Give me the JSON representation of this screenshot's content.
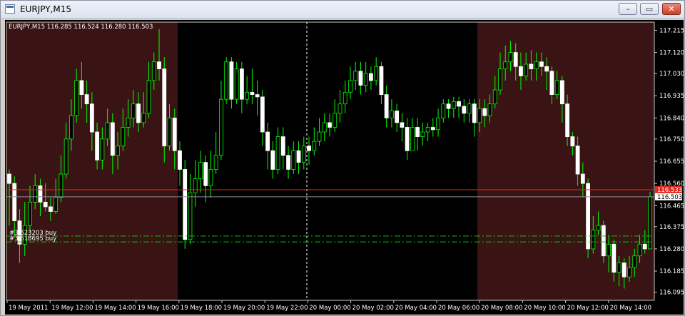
{
  "window": {
    "title": "EURJPY,M15",
    "minimize_glyph": "–",
    "restore_glyph": "▭",
    "close_glyph": "✕"
  },
  "chart_data": {
    "type": "candlestick",
    "header": "EURJPY,M15  116.285 116.524 116.280 116.503",
    "ylim": [
      116.06,
      117.25
    ],
    "y_ticks": [
      117.215,
      117.12,
      117.03,
      116.935,
      116.84,
      116.75,
      116.655,
      116.56,
      116.465,
      116.375,
      116.28,
      116.185,
      116.095
    ],
    "y_tick_labels": [
      "117.215",
      "117.120",
      "117.030",
      "116.935",
      "116.840",
      "116.750",
      "116.655",
      "116.560",
      "116.465",
      "116.375",
      "116.280",
      "116.185",
      "116.095"
    ],
    "x_tick_labels": [
      "19 May 2011",
      "19 May 12:00",
      "19 May 14:00",
      "19 May 16:00",
      "19 May 18:00",
      "19 May 20:00",
      "19 May 22:00",
      "20 May 00:00",
      "20 May 02:00",
      "20 May 04:00",
      "20 May 06:00",
      "20 May 08:00",
      "20 May 10:00",
      "20 May 12:00",
      "20 May 14:00"
    ],
    "price_lines": [
      {
        "label": "116.533",
        "value": 116.533,
        "color": "#e0281e"
      },
      {
        "label": "116.503",
        "value": 116.503,
        "color": "#8c8c9c"
      }
    ],
    "order_lines": [
      {
        "label": "#3  623203 buy",
        "value": 116.335
      },
      {
        "label": "#3  618695 buy",
        "value": 116.31
      }
    ],
    "session_shading": [
      "#3a1414",
      "#000000",
      "#3a1414"
    ],
    "candles": [
      [
        116.6,
        116.56,
        116.62,
        116.38
      ],
      [
        116.56,
        116.4,
        116.59,
        116.33
      ],
      [
        116.4,
        116.3,
        116.45,
        116.22
      ],
      [
        116.3,
        116.38,
        116.48,
        116.25
      ],
      [
        116.38,
        116.48,
        116.55,
        116.35
      ],
      [
        116.48,
        116.55,
        116.6,
        116.45
      ],
      [
        116.55,
        116.48,
        116.58,
        116.42
      ],
      [
        116.48,
        116.46,
        116.56,
        116.44
      ],
      [
        116.46,
        116.44,
        116.5,
        116.4
      ],
      [
        116.44,
        116.5,
        116.58,
        116.43
      ],
      [
        116.5,
        116.6,
        116.68,
        116.48
      ],
      [
        116.6,
        116.75,
        116.82,
        116.58
      ],
      [
        116.75,
        116.85,
        116.92,
        116.7
      ],
      [
        116.85,
        117.0,
        117.05,
        116.82
      ],
      [
        117.0,
        116.94,
        117.08,
        116.88
      ],
      [
        116.94,
        116.9,
        117.0,
        116.82
      ],
      [
        116.9,
        116.78,
        116.95,
        116.7
      ],
      [
        116.78,
        116.66,
        116.82,
        116.62
      ],
      [
        116.66,
        116.75,
        116.8,
        116.62
      ],
      [
        116.75,
        116.82,
        116.88,
        116.72
      ],
      [
        116.82,
        116.68,
        116.86,
        116.6
      ],
      [
        116.68,
        116.72,
        116.78,
        116.62
      ],
      [
        116.72,
        116.8,
        116.88,
        116.7
      ],
      [
        116.8,
        116.84,
        116.92,
        116.76
      ],
      [
        116.84,
        116.9,
        116.96,
        116.8
      ],
      [
        116.9,
        116.82,
        116.95,
        116.78
      ],
      [
        116.82,
        116.86,
        116.95,
        116.8
      ],
      [
        116.86,
        117.0,
        117.08,
        116.84
      ],
      [
        117.0,
        117.08,
        117.12,
        116.96
      ],
      [
        117.08,
        117.05,
        117.22,
        117.0
      ],
      [
        117.05,
        116.72,
        117.1,
        116.65
      ],
      [
        116.72,
        116.84,
        116.9,
        116.7
      ],
      [
        116.84,
        116.7,
        116.88,
        116.62
      ],
      [
        116.7,
        116.62,
        116.74,
        116.55
      ],
      [
        116.62,
        116.32,
        116.66,
        116.28
      ],
      [
        116.32,
        116.52,
        116.6,
        116.3
      ],
      [
        116.52,
        116.58,
        116.66,
        116.46
      ],
      [
        116.58,
        116.65,
        116.7,
        116.52
      ],
      [
        116.65,
        116.55,
        116.68,
        116.48
      ],
      [
        116.55,
        116.62,
        116.7,
        116.5
      ],
      [
        116.62,
        116.68,
        116.78,
        116.6
      ],
      [
        116.68,
        116.92,
        117.0,
        116.66
      ],
      [
        116.92,
        117.08,
        117.1,
        116.9
      ],
      [
        117.08,
        116.92,
        117.1,
        116.88
      ],
      [
        116.92,
        117.05,
        117.08,
        116.9
      ],
      [
        117.05,
        116.92,
        117.08,
        116.86
      ],
      [
        116.92,
        116.95,
        117.02,
        116.9
      ],
      [
        116.95,
        116.94,
        117.05,
        116.9
      ],
      [
        116.94,
        116.93,
        117.0,
        116.85
      ],
      [
        116.93,
        116.78,
        116.96,
        116.72
      ],
      [
        116.78,
        116.7,
        116.82,
        116.62
      ],
      [
        116.7,
        116.62,
        116.74,
        116.58
      ],
      [
        116.62,
        116.76,
        116.8,
        116.6
      ],
      [
        116.76,
        116.68,
        116.8,
        116.62
      ],
      [
        116.68,
        116.62,
        116.72,
        116.58
      ],
      [
        116.62,
        116.7,
        116.74,
        116.6
      ],
      [
        116.7,
        116.65,
        116.74,
        116.6
      ],
      [
        116.65,
        116.72,
        116.76,
        116.62
      ],
      [
        116.72,
        116.7,
        116.76,
        116.64
      ],
      [
        116.7,
        116.74,
        116.8,
        116.68
      ],
      [
        116.74,
        116.78,
        116.84,
        116.72
      ],
      [
        116.78,
        116.82,
        116.86,
        116.74
      ],
      [
        116.82,
        116.8,
        116.86,
        116.76
      ],
      [
        116.8,
        116.86,
        116.92,
        116.78
      ],
      [
        116.86,
        116.9,
        116.96,
        116.82
      ],
      [
        116.9,
        116.95,
        117.0,
        116.86
      ],
      [
        116.95,
        117.0,
        117.06,
        116.92
      ],
      [
        117.0,
        117.04,
        117.08,
        116.96
      ],
      [
        117.04,
        116.98,
        117.08,
        116.94
      ],
      [
        116.98,
        117.03,
        117.08,
        116.95
      ],
      [
        117.03,
        117.0,
        117.06,
        116.96
      ],
      [
        117.0,
        117.06,
        117.1,
        116.98
      ],
      [
        117.06,
        116.94,
        117.08,
        116.9
      ],
      [
        116.94,
        116.84,
        116.98,
        116.8
      ],
      [
        116.84,
        116.87,
        116.92,
        116.8
      ],
      [
        116.87,
        116.82,
        116.9,
        116.78
      ],
      [
        116.82,
        116.8,
        116.86,
        116.74
      ],
      [
        116.8,
        116.7,
        116.84,
        116.66
      ],
      [
        116.7,
        116.8,
        116.84,
        116.7
      ],
      [
        116.8,
        116.76,
        116.84,
        116.7
      ],
      [
        116.76,
        116.78,
        116.82,
        116.72
      ],
      [
        116.78,
        116.8,
        116.82,
        116.74
      ],
      [
        116.8,
        116.79,
        116.84,
        116.76
      ],
      [
        116.79,
        116.84,
        116.88,
        116.76
      ],
      [
        116.84,
        116.9,
        116.92,
        116.82
      ],
      [
        116.9,
        116.88,
        116.92,
        116.84
      ],
      [
        116.88,
        116.91,
        116.93,
        116.84
      ],
      [
        116.91,
        116.89,
        116.93,
        116.84
      ],
      [
        116.89,
        116.86,
        116.92,
        116.82
      ],
      [
        116.86,
        116.9,
        116.92,
        116.82
      ],
      [
        116.9,
        116.82,
        116.92,
        116.76
      ],
      [
        116.82,
        116.88,
        116.92,
        116.78
      ],
      [
        116.88,
        116.85,
        116.92,
        116.8
      ],
      [
        116.85,
        116.9,
        116.94,
        116.82
      ],
      [
        116.9,
        116.96,
        117.02,
        116.88
      ],
      [
        116.96,
        117.05,
        117.12,
        116.94
      ],
      [
        117.05,
        117.08,
        117.15,
        117.0
      ],
      [
        117.08,
        117.12,
        117.17,
        117.04
      ],
      [
        117.12,
        117.06,
        117.16,
        117.0
      ],
      [
        117.06,
        117.02,
        117.12,
        116.96
      ],
      [
        117.02,
        117.07,
        117.12,
        117.0
      ],
      [
        117.07,
        117.05,
        117.13,
        117.0
      ],
      [
        117.05,
        117.08,
        117.12,
        117.0
      ],
      [
        117.08,
        117.06,
        117.12,
        117.02
      ],
      [
        117.06,
        117.04,
        117.1,
        116.96
      ],
      [
        117.04,
        116.94,
        117.06,
        116.9
      ],
      [
        116.94,
        117.0,
        117.04,
        116.92
      ],
      [
        117.0,
        116.9,
        117.02,
        116.82
      ],
      [
        116.9,
        116.76,
        116.94,
        116.72
      ],
      [
        116.76,
        116.72,
        116.78,
        116.68
      ],
      [
        116.72,
        116.6,
        116.76,
        116.55
      ],
      [
        116.6,
        116.56,
        116.65,
        116.5
      ],
      [
        116.56,
        116.28,
        116.58,
        116.24
      ],
      [
        116.28,
        116.36,
        116.42,
        116.26
      ],
      [
        116.36,
        116.38,
        116.44,
        116.34
      ],
      [
        116.38,
        116.25,
        116.4,
        116.22
      ],
      [
        116.25,
        116.3,
        116.34,
        116.18
      ],
      [
        116.3,
        116.18,
        116.32,
        116.14
      ],
      [
        116.18,
        116.22,
        116.25,
        116.12
      ],
      [
        116.22,
        116.16,
        116.24,
        116.11
      ],
      [
        116.16,
        116.2,
        116.25,
        116.14
      ],
      [
        116.2,
        116.25,
        116.28,
        116.16
      ],
      [
        116.25,
        116.3,
        116.34,
        116.22
      ],
      [
        116.3,
        116.28,
        116.36,
        116.26
      ],
      [
        116.28,
        116.503,
        116.524,
        116.28
      ]
    ]
  }
}
